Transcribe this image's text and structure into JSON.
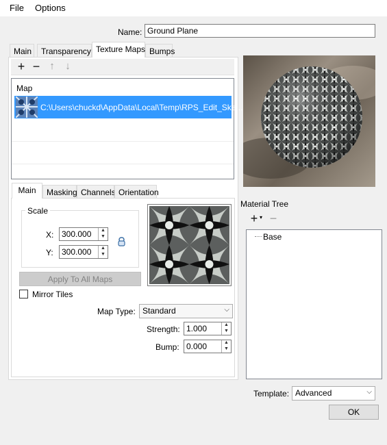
{
  "menu": {
    "file": "File",
    "options": "Options"
  },
  "name": {
    "label": "Name:",
    "value": "Ground Plane"
  },
  "top_tabs": [
    "Main",
    "Transparency",
    "Texture Maps",
    "Bumps"
  ],
  "maps_list": {
    "header": "Map",
    "rows": [
      "C:\\Users\\chuckd\\AppData\\Local\\Temp\\RPS_Edit_Ske..."
    ]
  },
  "sub_tabs": [
    "Main",
    "Masking",
    "Channels",
    "Orientation"
  ],
  "scale": {
    "title": "Scale",
    "x_label": "X:",
    "x_value": "300.000",
    "y_label": "Y:",
    "y_value": "300.000"
  },
  "apply_button": "Apply To All Maps",
  "mirror_tiles": {
    "label": "Mirror Tiles",
    "checked": false
  },
  "map_type": {
    "label": "Map Type:",
    "value": "Standard"
  },
  "strength": {
    "label": "Strength:",
    "value": "1.000"
  },
  "bump": {
    "label": "Bump:",
    "value": "0.000"
  },
  "material_tree": {
    "title": "Material Tree",
    "items": [
      "Base"
    ]
  },
  "template": {
    "label": "Template:",
    "value": "Advanced"
  },
  "ok_button": "OK",
  "icons": {
    "add": "plus-icon",
    "remove": "minus-icon",
    "up": "arrow-up-icon",
    "down": "arrow-down-icon",
    "lock": "link-lock-icon",
    "dropdown": "chevron-down-icon"
  },
  "colors": {
    "selection": "#3399ff",
    "accent_icon": "#3a6ea5"
  }
}
